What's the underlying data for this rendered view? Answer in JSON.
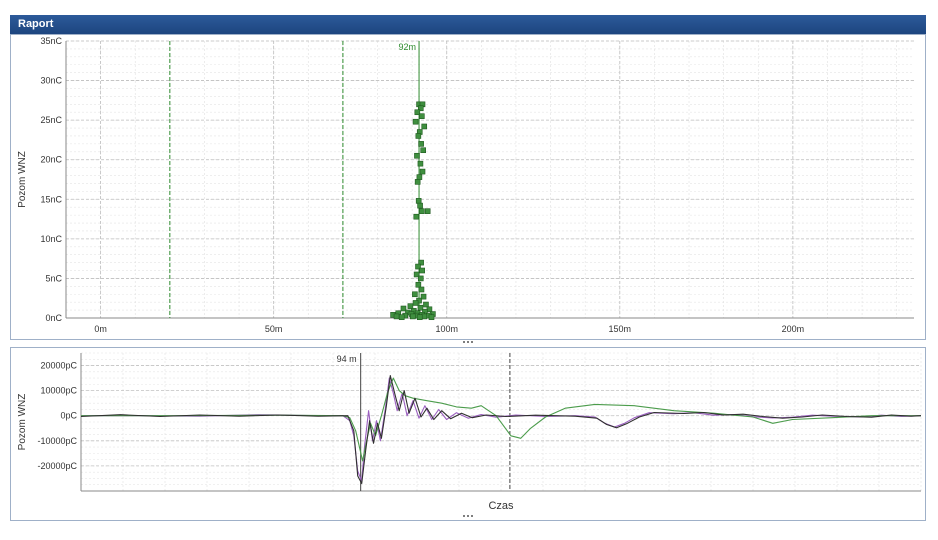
{
  "window": {
    "title": "Raport"
  },
  "chart_data": [
    {
      "type": "scatter",
      "ylabel": "Pozom WNZ",
      "xlim": [
        -10,
        235
      ],
      "ylim": [
        0,
        35
      ],
      "x_ticks": [
        {
          "v": 0,
          "label": "0m"
        },
        {
          "v": 50,
          "label": "50m"
        },
        {
          "v": 100,
          "label": "100m"
        },
        {
          "v": 150,
          "label": "150m"
        },
        {
          "v": 200,
          "label": "200m"
        }
      ],
      "y_ticks": [
        {
          "v": 0,
          "label": "0nC"
        },
        {
          "v": 5,
          "label": "5nC"
        },
        {
          "v": 10,
          "label": "10nC"
        },
        {
          "v": 15,
          "label": "15nC"
        },
        {
          "v": 20,
          "label": "20nC"
        },
        {
          "v": 25,
          "label": "25nC"
        },
        {
          "v": 30,
          "label": "30nC"
        },
        {
          "v": 35,
          "label": "35nC"
        }
      ],
      "markers": [
        {
          "x": 20,
          "style": "dashed",
          "label": ""
        },
        {
          "x": 70,
          "style": "dashed",
          "label": ""
        },
        {
          "x": 92,
          "style": "solid",
          "label": "92m"
        }
      ],
      "points": [
        [
          92.0,
          27.0
        ],
        [
          93.0,
          27.0
        ],
        [
          92.5,
          26.5
        ],
        [
          91.5,
          26.0
        ],
        [
          92.8,
          25.5
        ],
        [
          91.0,
          24.8
        ],
        [
          93.5,
          24.2
        ],
        [
          92.2,
          23.5
        ],
        [
          91.8,
          23.0
        ],
        [
          92.6,
          22.0
        ],
        [
          93.2,
          21.2
        ],
        [
          91.4,
          20.5
        ],
        [
          92.4,
          19.5
        ],
        [
          93.0,
          18.5
        ],
        [
          91.6,
          17.2
        ],
        [
          92.1,
          17.8
        ],
        [
          91.9,
          14.8
        ],
        [
          92.3,
          14.2
        ],
        [
          92.8,
          13.5
        ],
        [
          94.5,
          13.5
        ],
        [
          91.2,
          12.8
        ],
        [
          92.6,
          7.0
        ],
        [
          91.7,
          6.5
        ],
        [
          92.9,
          6.0
        ],
        [
          91.3,
          5.5
        ],
        [
          92.5,
          5.0
        ],
        [
          91.8,
          4.2
        ],
        [
          92.7,
          3.6
        ],
        [
          90.8,
          3.0
        ],
        [
          93.3,
          2.7
        ],
        [
          92.0,
          2.2
        ],
        [
          91.0,
          1.9
        ],
        [
          94.0,
          1.7
        ],
        [
          89.5,
          1.5
        ],
        [
          92.4,
          1.3
        ],
        [
          87.5,
          1.2
        ],
        [
          95.0,
          1.1
        ],
        [
          90.5,
          0.9
        ],
        [
          93.7,
          0.8
        ],
        [
          88.8,
          0.7
        ],
        [
          91.6,
          0.6
        ],
        [
          86.0,
          0.6
        ],
        [
          96.0,
          0.5
        ],
        [
          89.8,
          0.5
        ],
        [
          92.9,
          0.4
        ],
        [
          84.5,
          0.4
        ],
        [
          94.8,
          0.3
        ],
        [
          88.0,
          0.3
        ],
        [
          91.2,
          0.3
        ],
        [
          90.2,
          0.2
        ],
        [
          93.5,
          0.2
        ],
        [
          85.5,
          0.2
        ],
        [
          92.2,
          0.1
        ],
        [
          95.6,
          0.1
        ],
        [
          87.0,
          0.1
        ]
      ]
    },
    {
      "type": "line",
      "xlabel": "Czas",
      "ylabel": "Pozom WNZ",
      "xlim": [
        0,
        850
      ],
      "ylim": [
        -30000,
        25000
      ],
      "y_ticks": [
        {
          "v": 20000,
          "label": "20000pC"
        },
        {
          "v": 10000,
          "label": "10000pC"
        },
        {
          "v": 0,
          "label": "0pC"
        },
        {
          "v": -10000,
          "label": "-10000pC"
        },
        {
          "v": -20000,
          "label": "-20000pC"
        }
      ],
      "markers": [
        {
          "x": 283,
          "style": "solid",
          "label": "94 m"
        },
        {
          "x": 434,
          "style": "dashed",
          "label": ""
        }
      ],
      "series": [
        {
          "name": "",
          "color": "#9b5fc0",
          "points": [
            [
              0,
              0
            ],
            [
              60,
              0
            ],
            [
              120,
              -200
            ],
            [
              180,
              400
            ],
            [
              240,
              0
            ],
            [
              265,
              0
            ],
            [
              272,
              -2000
            ],
            [
              276,
              -8000
            ],
            [
              280,
              -22000
            ],
            [
              284,
              -26000
            ],
            [
              287,
              -12000
            ],
            [
              291,
              2000
            ],
            [
              295,
              -10000
            ],
            [
              299,
              -2000
            ],
            [
              303,
              -10000
            ],
            [
              308,
              3000
            ],
            [
              312,
              15000
            ],
            [
              316,
              9000
            ],
            [
              320,
              2000
            ],
            [
              325,
              9000
            ],
            [
              330,
              0
            ],
            [
              336,
              6000
            ],
            [
              342,
              -1000
            ],
            [
              348,
              4000
            ],
            [
              355,
              -1500
            ],
            [
              362,
              2500
            ],
            [
              370,
              -1500
            ],
            [
              380,
              1200
            ],
            [
              392,
              -1000
            ],
            [
              405,
              500
            ],
            [
              420,
              -600
            ],
            [
              440,
              300
            ],
            [
              470,
              -300
            ],
            [
              500,
              0
            ],
            [
              520,
              -500
            ],
            [
              530,
              -3000
            ],
            [
              540,
              -4500
            ],
            [
              550,
              -3000
            ],
            [
              560,
              -800
            ],
            [
              575,
              1200
            ],
            [
              600,
              800
            ],
            [
              620,
              1200
            ],
            [
              640,
              200
            ],
            [
              660,
              500
            ],
            [
              680,
              -400
            ],
            [
              700,
              -900
            ],
            [
              720,
              -600
            ],
            [
              740,
              200
            ],
            [
              760,
              -200
            ],
            [
              790,
              -500
            ],
            [
              810,
              200
            ],
            [
              830,
              -300
            ],
            [
              850,
              0
            ]
          ]
        },
        {
          "name": "",
          "color": "#4c9c4c",
          "points": [
            [
              0,
              0
            ],
            [
              100,
              0
            ],
            [
              200,
              200
            ],
            [
              265,
              0
            ],
            [
              272,
              -800
            ],
            [
              278,
              -6000
            ],
            [
              285,
              -18000
            ],
            [
              289,
              -10000
            ],
            [
              293,
              -3000
            ],
            [
              298,
              -8000
            ],
            [
              304,
              0
            ],
            [
              310,
              9000
            ],
            [
              316,
              15000
            ],
            [
              322,
              10000
            ],
            [
              328,
              8000
            ],
            [
              336,
              7000
            ],
            [
              350,
              6000
            ],
            [
              365,
              5000
            ],
            [
              380,
              3500
            ],
            [
              395,
              3000
            ],
            [
              405,
              4000
            ],
            [
              420,
              0
            ],
            [
              435,
              -8000
            ],
            [
              445,
              -9000
            ],
            [
              455,
              -5000
            ],
            [
              470,
              -500
            ],
            [
              490,
              3000
            ],
            [
              520,
              4500
            ],
            [
              560,
              4000
            ],
            [
              600,
              2000
            ],
            [
              640,
              1000
            ],
            [
              680,
              -500
            ],
            [
              700,
              -3000
            ],
            [
              720,
              -1500
            ],
            [
              760,
              -800
            ],
            [
              800,
              0
            ],
            [
              850,
              0
            ]
          ]
        },
        {
          "name": "",
          "color": "#303030",
          "points": [
            [
              0,
              -300
            ],
            [
              40,
              400
            ],
            [
              80,
              -300
            ],
            [
              120,
              300
            ],
            [
              160,
              -200
            ],
            [
              200,
              300
            ],
            [
              240,
              -200
            ],
            [
              270,
              0
            ],
            [
              276,
              -6000
            ],
            [
              280,
              -24000
            ],
            [
              284,
              -27000
            ],
            [
              288,
              -14000
            ],
            [
              292,
              -2000
            ],
            [
              296,
              -11000
            ],
            [
              300,
              -3000
            ],
            [
              304,
              -9000
            ],
            [
              309,
              4000
            ],
            [
              313,
              16000
            ],
            [
              318,
              8000
            ],
            [
              322,
              2000
            ],
            [
              327,
              10000
            ],
            [
              332,
              1000
            ],
            [
              338,
              7000
            ],
            [
              344,
              -500
            ],
            [
              350,
              3000
            ],
            [
              357,
              -1500
            ],
            [
              365,
              2000
            ],
            [
              374,
              -1200
            ],
            [
              385,
              1000
            ],
            [
              396,
              -800
            ],
            [
              410,
              300
            ],
            [
              430,
              -300
            ],
            [
              460,
              200
            ],
            [
              500,
              -200
            ],
            [
              522,
              -1000
            ],
            [
              532,
              -3500
            ],
            [
              542,
              -4800
            ],
            [
              552,
              -3200
            ],
            [
              565,
              -500
            ],
            [
              580,
              1300
            ],
            [
              610,
              900
            ],
            [
              630,
              1300
            ],
            [
              650,
              300
            ],
            [
              670,
              600
            ],
            [
              690,
              -300
            ],
            [
              710,
              -1000
            ],
            [
              730,
              -500
            ],
            [
              750,
              300
            ],
            [
              775,
              -300
            ],
            [
              800,
              -600
            ],
            [
              820,
              300
            ],
            [
              840,
              -200
            ],
            [
              850,
              0
            ]
          ]
        }
      ]
    }
  ]
}
